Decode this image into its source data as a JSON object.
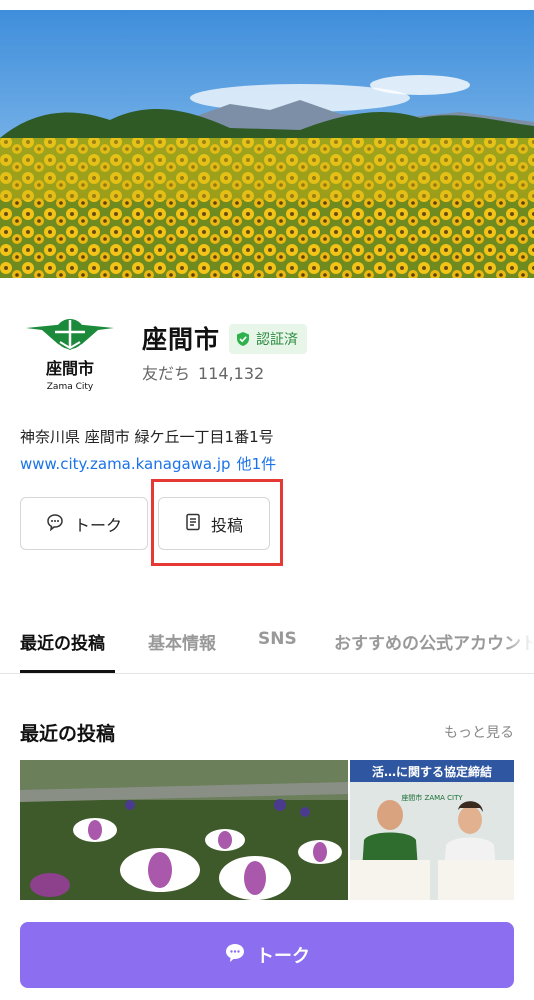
{
  "account": {
    "name": "座間市",
    "verified_label": "認証済",
    "friends_label": "友だち",
    "friends_count": "114,132",
    "logo_text": "座間市",
    "logo_subtext": "Zama City"
  },
  "profile": {
    "address": "神奈川県 座間市 緑ケ丘一丁目1番1号",
    "website": "www.city.zama.kanagawa.jp",
    "website_more": "他1件"
  },
  "actions": {
    "talk_label": "トーク",
    "post_label": "投稿"
  },
  "tabs": [
    {
      "label": "最近の投稿",
      "active": true
    },
    {
      "label": "基本情報",
      "active": false
    },
    {
      "label": "SNS",
      "active": false
    },
    {
      "label": "おすすめの公式アカウント",
      "active": false
    }
  ],
  "recent_posts": {
    "title": "最近の投稿",
    "see_more": "もっと見る",
    "post2_banner": "活…に関する協定締結",
    "post2_caption": "座間市 ZAMA CITY"
  },
  "cta": {
    "label": "トーク"
  },
  "colors": {
    "accent": "#8c6ff0",
    "link": "#1a73e8",
    "verified": "#2b8a3e",
    "highlight": "#e53935"
  }
}
